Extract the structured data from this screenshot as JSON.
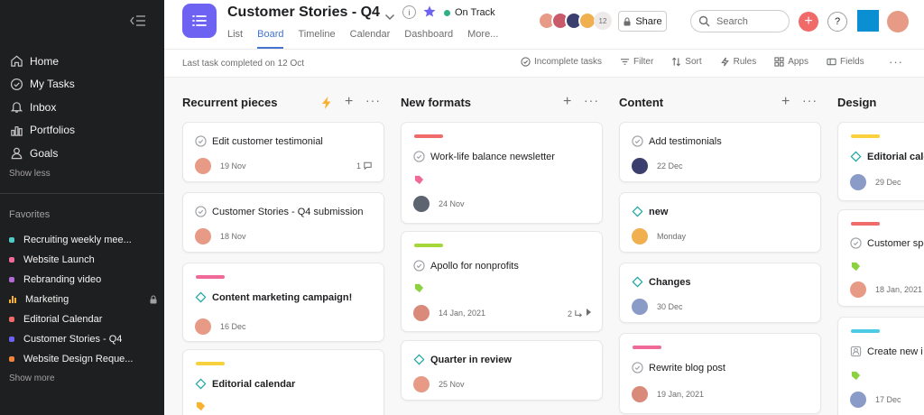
{
  "sidebar": {
    "nav": [
      {
        "label": "Home",
        "icon": "home-icon"
      },
      {
        "label": "My Tasks",
        "icon": "check-circle-icon"
      },
      {
        "label": "Inbox",
        "icon": "bell-icon"
      },
      {
        "label": "Portfolios",
        "icon": "bar-chart-icon"
      },
      {
        "label": "Goals",
        "icon": "person-icon"
      }
    ],
    "show_less": "Show less",
    "favorites_title": "Favorites",
    "favorites": [
      {
        "label": "Recruiting weekly mee...",
        "color": "#4ecbc4"
      },
      {
        "label": "Website Launch",
        "color": "#f06a99"
      },
      {
        "label": "Rebranding video",
        "color": "#b36bd4"
      },
      {
        "label": "Marketing",
        "color": "#f8b230"
      },
      {
        "label": "Editorial Calendar",
        "color": "#f06a6a"
      },
      {
        "label": "Customer Stories - Q4",
        "color": "#6e62f3"
      },
      {
        "label": "Website Design Reque...",
        "color": "#f1833b"
      }
    ],
    "show_more": "Show more"
  },
  "header": {
    "project_title": "Customer Stories - Q4",
    "status": "On Track",
    "status_color": "#2fb188",
    "tabs": [
      "List",
      "Board",
      "Timeline",
      "Calendar",
      "Dashboard",
      "More..."
    ],
    "active_tab": "Board",
    "member_count": "12",
    "share_label": "Share",
    "search_placeholder": "Search",
    "help_label": "?"
  },
  "toolbar": {
    "last_task": "Last task completed on 12 Oct",
    "incomplete": "Incomplete tasks",
    "filter": "Filter",
    "sort": "Sort",
    "rules": "Rules",
    "apps": "Apps",
    "fields": "Fields"
  },
  "board": {
    "columns": [
      {
        "title": "Recurrent pieces",
        "cards": [
          {
            "title": "Edit customer testimonial",
            "date": "19 Nov",
            "comments": "1"
          },
          {
            "title": "Customer Stories - Q4 submission",
            "date": "18 Nov"
          },
          {
            "title": "Content marketing campaign!",
            "date": "16 Dec",
            "strip": "#f06a99",
            "milestone": true
          },
          {
            "title": "Editorial calendar",
            "strip": "#f8d13c",
            "milestone": true,
            "tag": "#f8b230"
          }
        ]
      },
      {
        "title": "New formats",
        "cards": [
          {
            "title": "Work-life balance newsletter",
            "date": "24 Nov",
            "strip": "#f06a6a",
            "tag": "#f06a99"
          },
          {
            "title": "Apollo for nonprofits",
            "date": "14 Jan, 2021",
            "strip": "#a5d63a",
            "tag": "#8bd140",
            "subtasks": "2"
          },
          {
            "title": "Quarter in review",
            "date": "25 Nov",
            "milestone": true
          }
        ]
      },
      {
        "title": "Content",
        "cards": [
          {
            "title": "Add testimonials",
            "date": "22 Dec"
          },
          {
            "title": "new",
            "date": "Monday",
            "milestone": true
          },
          {
            "title": "Changes",
            "date": "30 Dec",
            "milestone": true
          },
          {
            "title": "Rewrite blog post",
            "date": "19 Jan, 2021",
            "strip": "#f06a99"
          }
        ]
      },
      {
        "title": "Design",
        "cards": [
          {
            "title": "Editorial cale",
            "date": "29 Dec",
            "strip": "#f8d13c",
            "milestone": true
          },
          {
            "title": "Customer spo",
            "date": "18 Jan, 2021",
            "strip": "#f06a6a",
            "tag": "#8bd140"
          },
          {
            "title": "Create new i",
            "date": "17 Dec",
            "strip": "#4ecbe4",
            "tag": "#8bd140",
            "approval": true
          }
        ]
      }
    ]
  }
}
